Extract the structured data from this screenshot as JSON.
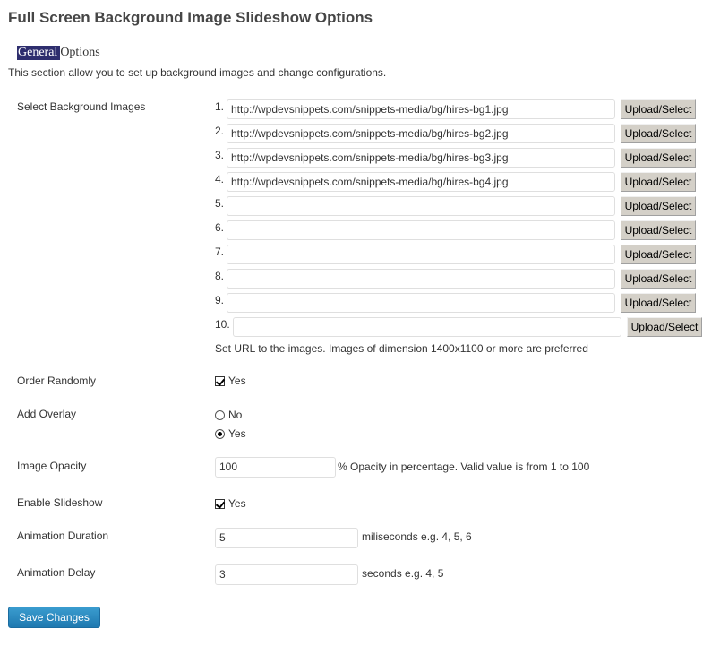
{
  "page_title": "Full Screen Background Image Slideshow Options",
  "section": {
    "heading_highlight": "General",
    "heading_rest": "Options",
    "description": "This section allow you to set up background images and change configurations."
  },
  "images": {
    "label": "Select Background Images",
    "button_label": "Upload/Select",
    "rows": [
      {
        "num": "1.",
        "value": "http://wpdevsnippets.com/snippets-media/bg/hires-bg1.jpg"
      },
      {
        "num": "2.",
        "value": "http://wpdevsnippets.com/snippets-media/bg/hires-bg2.jpg"
      },
      {
        "num": "3.",
        "value": "http://wpdevsnippets.com/snippets-media/bg/hires-bg3.jpg"
      },
      {
        "num": "4.",
        "value": "http://wpdevsnippets.com/snippets-media/bg/hires-bg4.jpg"
      },
      {
        "num": "5.",
        "value": ""
      },
      {
        "num": "6.",
        "value": ""
      },
      {
        "num": "7.",
        "value": ""
      },
      {
        "num": "8.",
        "value": ""
      },
      {
        "num": "9.",
        "value": ""
      },
      {
        "num": "10.",
        "value": ""
      }
    ],
    "help": "Set URL to the images. Images of dimension 1400x1100 or more are preferred"
  },
  "order_randomly": {
    "label": "Order Randomly",
    "option": "Yes",
    "checked": true
  },
  "add_overlay": {
    "label": "Add Overlay",
    "options": [
      "No",
      "Yes"
    ],
    "selected": "Yes"
  },
  "image_opacity": {
    "label": "Image Opacity",
    "value": "100",
    "suffix": "% Opacity in percentage. Valid value is from 1 to 100"
  },
  "enable_slideshow": {
    "label": "Enable Slideshow",
    "option": "Yes",
    "checked": true
  },
  "animation_duration": {
    "label": "Animation Duration",
    "value": "5",
    "suffix": "miliseconds e.g. 4, 5, 6"
  },
  "animation_delay": {
    "label": "Animation Delay",
    "value": "3",
    "suffix": "seconds e.g. 4, 5"
  },
  "save_label": "Save Changes"
}
